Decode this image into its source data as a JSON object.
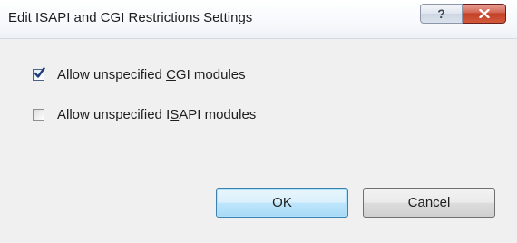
{
  "window": {
    "title": "Edit ISAPI and CGI Restrictions Settings",
    "help_glyph": "?",
    "close_icon": "close-x-icon"
  },
  "options": [
    {
      "label_before": "Allow unspecified ",
      "label_mnemonic": "C",
      "label_after": "GI modules",
      "checked": true
    },
    {
      "label_before": "Allow unspecified I",
      "label_mnemonic": "S",
      "label_after": "API modules",
      "checked": false
    }
  ],
  "buttons": {
    "ok_label": "OK",
    "cancel_label": "Cancel"
  },
  "colors": {
    "close_button": "#c24026",
    "ok_border": "#3c7fb1",
    "checkmark": "#1f3f7a"
  }
}
